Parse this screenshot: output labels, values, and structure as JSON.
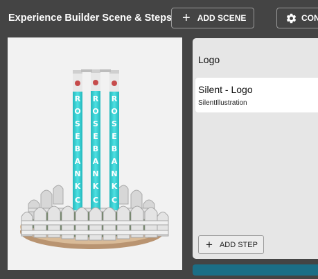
{
  "header": {
    "title": "Experience Builder Scene & Steps",
    "add_scene_label": "ADD SCENE",
    "config_label": "CON"
  },
  "preview": {
    "stump_letters": [
      "R",
      "O",
      "S",
      "E",
      "B",
      "A",
      "N",
      "K",
      "C",
      "C"
    ]
  },
  "steps_panel": {
    "scene_name": "Logo",
    "steps": [
      {
        "title": "Silent - Logo",
        "type": "SilentIllustration"
      }
    ],
    "add_step_label": "ADD STEP"
  },
  "colors": {
    "background": "#444444",
    "accent_bar": "#1b6e86",
    "stump_cyan": "#3fd3d6"
  },
  "icons": {
    "add_scene": "plus-icon",
    "config": "gear-icon",
    "add_step": "plus-icon"
  }
}
